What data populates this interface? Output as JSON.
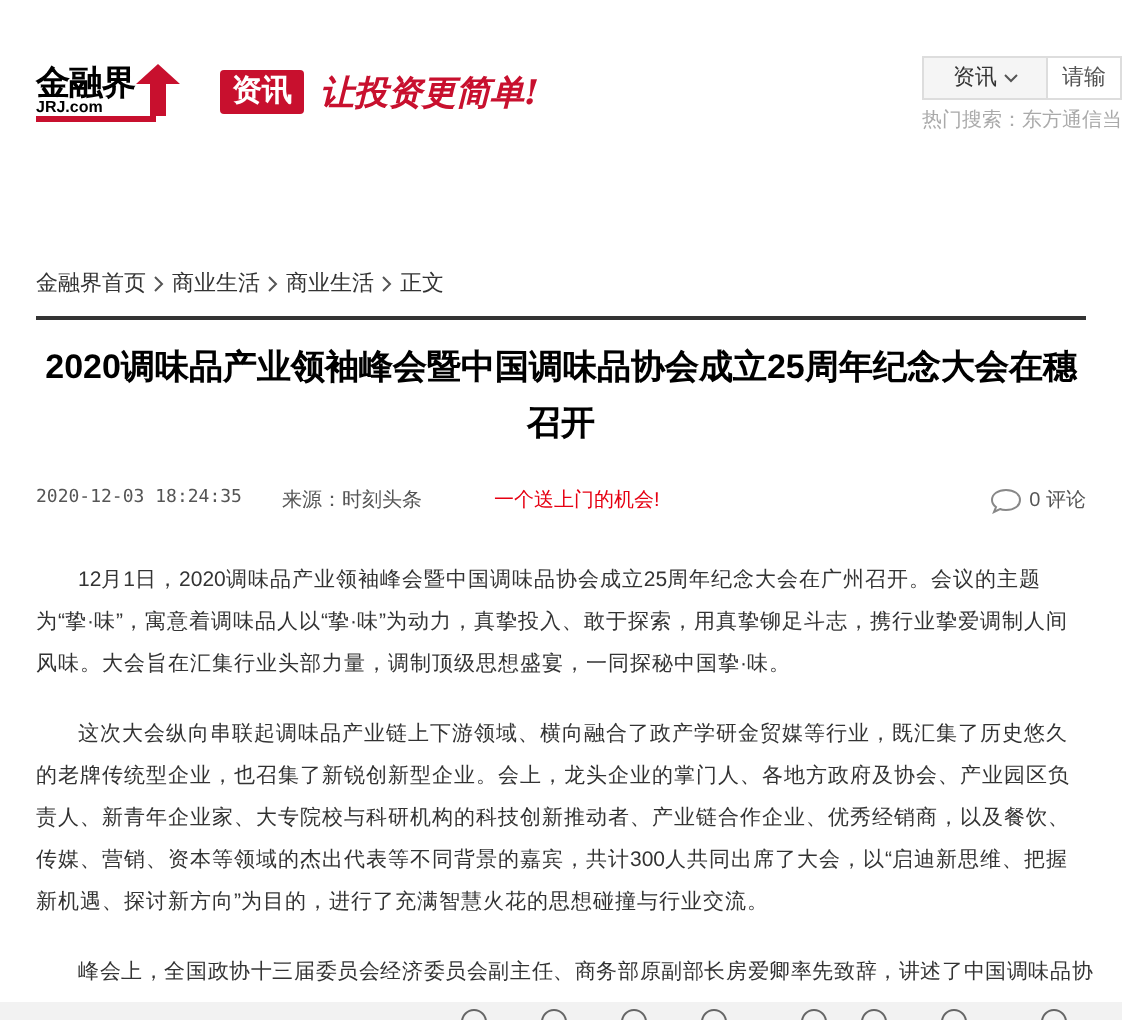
{
  "header": {
    "logo": {
      "name": "金融界",
      "domain": "JRJ.com"
    },
    "channel_badge": "资讯",
    "slogan": "让投资更简单!",
    "search": {
      "category": "资讯",
      "placeholder": "请输",
      "hot_label": "热门搜索：",
      "hot_terms": [
        "东方通信",
        "当"
      ]
    }
  },
  "breadcrumb": [
    "金融界首页",
    "商业生活",
    "商业生活",
    "正文"
  ],
  "article": {
    "title": "2020调味品产业领袖峰会暨中国调味品协会成立25周年纪念大会在穗召开",
    "date": "2020-12-03 18:24:35",
    "source": "来源：时刻头条",
    "promo": "一个送上门的机会!",
    "comments": "0 评论",
    "paragraphs": [
      "12月1日，2020调味品产业领袖峰会暨中国调味品协会成立25周年纪念大会在广州召开。会议的主题为“挚·味”，寓意着调味品人以“挚·味”为动力，真挚投入、敢于探索，用真挚铆足斗志，携行业挚爱调制人间风味。大会旨在汇集行业头部力量，调制顶级思想盛宴，一同探秘中国挚·味。",
      "这次大会纵向串联起调味品产业链上下游领域、横向融合了政产学研金贸媒等行业，既汇集了历史悠久的老牌传统型企业，也召集了新锐创新型企业。会上，龙头企业的掌门人、各地方政府及协会、产业园区负责人、新青年企业家、大专院校与科研机构的科技创新推动者、产业链合作企业、优秀经销商，以及餐饮、传媒、营销、资本等领域的杰出代表等不同背景的嘉宾，共计300人共同出席了大会，以“启迪新思维、把握新机遇、探讨新方向”为目的，进行了充满智慧火花的思想碰撞与行业交流。",
      "峰会上，全国政协十三届委员会经济委员会副主任、商务部原副部长房爱卿率先致辞，讲述了中国调味品协"
    ]
  }
}
